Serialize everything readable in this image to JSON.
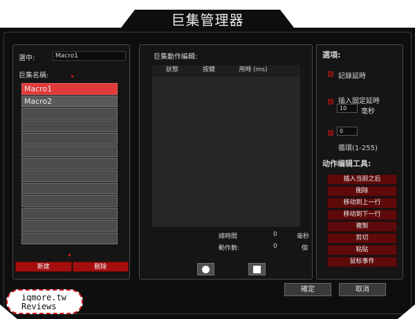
{
  "window": {
    "title": "巨集管理器",
    "minimize_glyph": "",
    "close_glyph": "✕"
  },
  "left_panel": {
    "selected_label": "選中:",
    "selected_value": "Macro1",
    "macro_name_label": "巨集名稱:",
    "macros": [
      {
        "label": "Macro1",
        "selected": true
      },
      {
        "label": "Macro2",
        "selected": false
      },
      {
        "label": "",
        "selected": false
      },
      {
        "label": "",
        "selected": false
      },
      {
        "label": "",
        "selected": false
      },
      {
        "label": "",
        "selected": false
      },
      {
        "label": "",
        "selected": false
      },
      {
        "label": "",
        "selected": false
      },
      {
        "label": "",
        "selected": false
      },
      {
        "label": "",
        "selected": false
      },
      {
        "label": "",
        "selected": false
      },
      {
        "label": "",
        "selected": false
      },
      {
        "label": "",
        "selected": false
      }
    ],
    "new_button": "新建",
    "delete_button": "刪除"
  },
  "middle_panel": {
    "title": "巨集動作編輯:",
    "columns": [
      "狀態",
      "按鍵",
      "用時 (ms)"
    ],
    "total_time_label": "總時間",
    "total_time_value": "0",
    "total_time_unit": "毫秒",
    "action_count_label": "動作數:",
    "action_count_value": "0",
    "action_count_unit": "個",
    "record_icon": "record-icon",
    "stop_icon": "stop-icon"
  },
  "right_panel": {
    "options_title": "選項:",
    "record_delay_label": "記錄延時",
    "insert_fixed_delay_label": "插入固定延時",
    "fixed_delay_value": "10",
    "fixed_delay_unit": "毫秒",
    "loop_value": "0",
    "loop_label": "循環(1-255)",
    "tools_title": "动作编辑工具:",
    "tools": [
      "插入当前之后",
      "刪除",
      "移动到上一行",
      "移动到下一行",
      "複製",
      "剪切",
      "粘貼",
      "鼠标事件"
    ]
  },
  "footer": {
    "confirm_button": "確定",
    "cancel_button": "取消"
  },
  "watermark": {
    "line1": "iqmore.tw",
    "line2": "Reviews"
  },
  "colors": {
    "accent_red": "#e03a3a",
    "button_red": "#a50f0f",
    "tool_red": "#5e0a0a",
    "background": "#0e0e0e"
  }
}
